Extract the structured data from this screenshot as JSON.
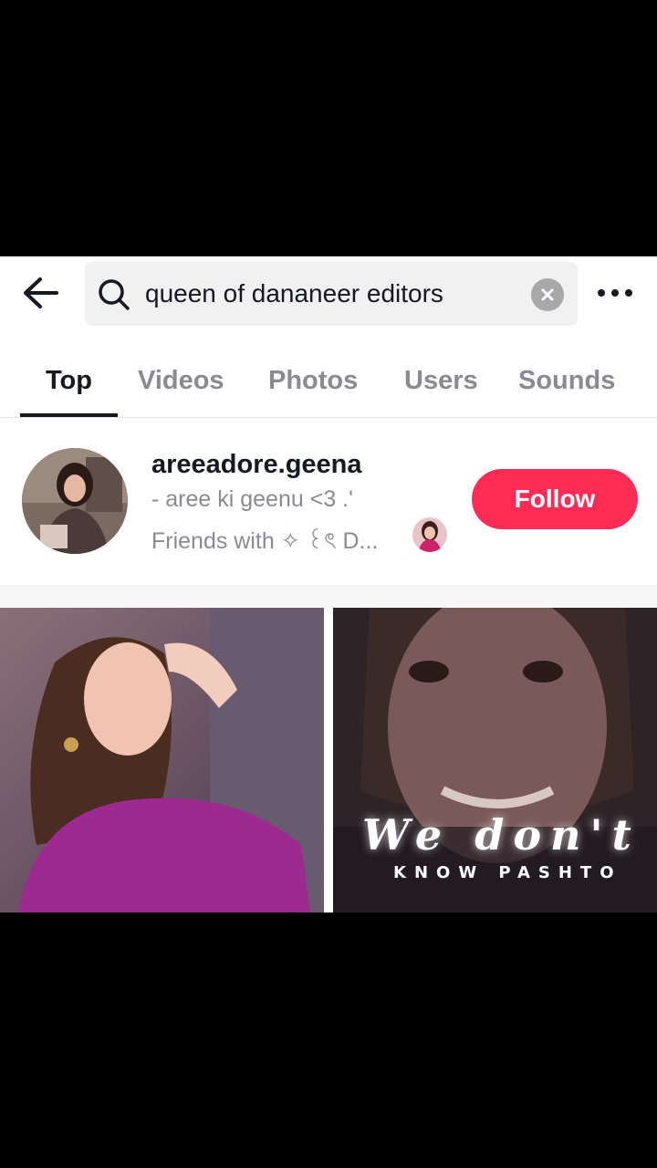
{
  "search": {
    "query": "queen of dananeer editors"
  },
  "tabs": [
    {
      "label": "Top",
      "active": true
    },
    {
      "label": "Videos"
    },
    {
      "label": "Photos"
    },
    {
      "label": "Users"
    },
    {
      "label": "Sounds"
    }
  ],
  "user": {
    "username": "areeadore.geena",
    "bio": "- aree ki geenu <3 .'",
    "friends": "Friends with ✧ ꒰ৎ D...",
    "follow_label": "Follow"
  },
  "videos": [
    {
      "overlay_title": "",
      "overlay_sub": ""
    },
    {
      "overlay_title": "We don't",
      "overlay_sub": "KNOW PASHTO"
    }
  ],
  "colors": {
    "accent": "#fe2c55",
    "text_primary": "#161823",
    "text_secondary": "#8a8b91"
  },
  "icons": [
    "back-arrow-icon",
    "search-icon",
    "clear-icon",
    "more-icon"
  ]
}
